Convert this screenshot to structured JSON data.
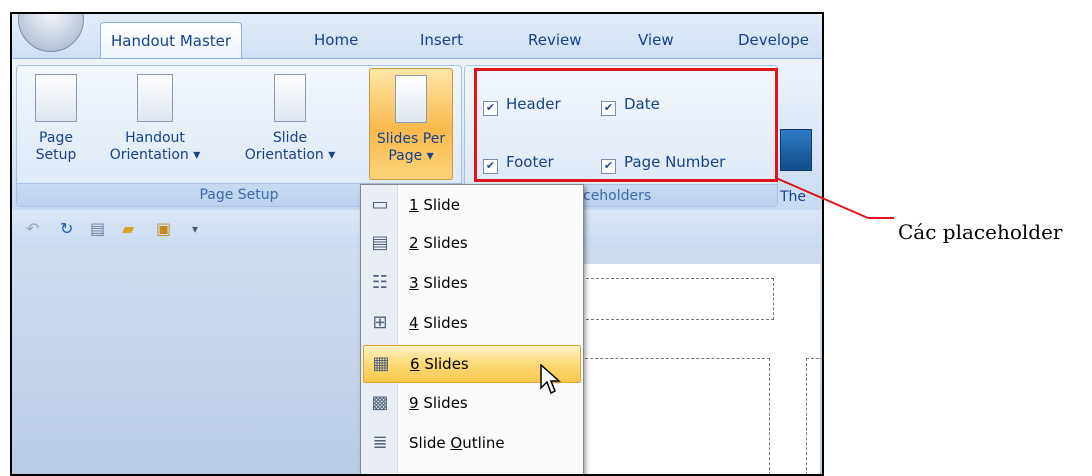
{
  "tabs": [
    {
      "label": "Handout Master",
      "active": true
    },
    {
      "label": "Home"
    },
    {
      "label": "Insert"
    },
    {
      "label": "Review"
    },
    {
      "label": "View"
    },
    {
      "label": "Develope"
    }
  ],
  "page_setup": {
    "buttons": [
      {
        "line1": "Page",
        "line2": "Setup"
      },
      {
        "line1": "Handout",
        "line2": "Orientation ▾"
      },
      {
        "line1": "Slide",
        "line2": "Orientation ▾"
      },
      {
        "line1": "Slides Per",
        "line2": "Page ▾"
      }
    ],
    "group_label": "Page Setup"
  },
  "placeholders": {
    "header": {
      "label": "Header",
      "checked": true
    },
    "date": {
      "label": "Date",
      "checked": true
    },
    "footer": {
      "label": "Footer",
      "checked": true
    },
    "page_number": {
      "label": "Page Number",
      "checked": true
    },
    "group_label_visible": "ceholders",
    "check_glyph": "✔"
  },
  "theme_button": {
    "label": "The"
  },
  "menu": {
    "items": [
      {
        "num": "1",
        "label": " Slide",
        "icon": "layout-1-icon",
        "glyph": "▭"
      },
      {
        "num": "2",
        "label": " Slides",
        "icon": "layout-2-icon",
        "glyph": "▤"
      },
      {
        "num": "3",
        "label": " Slides",
        "icon": "layout-3-icon",
        "glyph": "☷"
      },
      {
        "num": "4",
        "label": " Slides",
        "icon": "layout-4-icon",
        "glyph": "⊞"
      },
      {
        "num": "6",
        "label": " Slides",
        "icon": "layout-6-icon",
        "glyph": "▦",
        "highlighted": true
      },
      {
        "num": "9",
        "label": " Slides",
        "icon": "layout-9-icon",
        "glyph": "▩"
      },
      {
        "pre": "Slide ",
        "ul": "O",
        "post": "utline",
        "icon": "outline-icon",
        "glyph": "≣"
      }
    ]
  },
  "callout": {
    "text": "Các placeholder",
    "color": "#e0141a"
  }
}
